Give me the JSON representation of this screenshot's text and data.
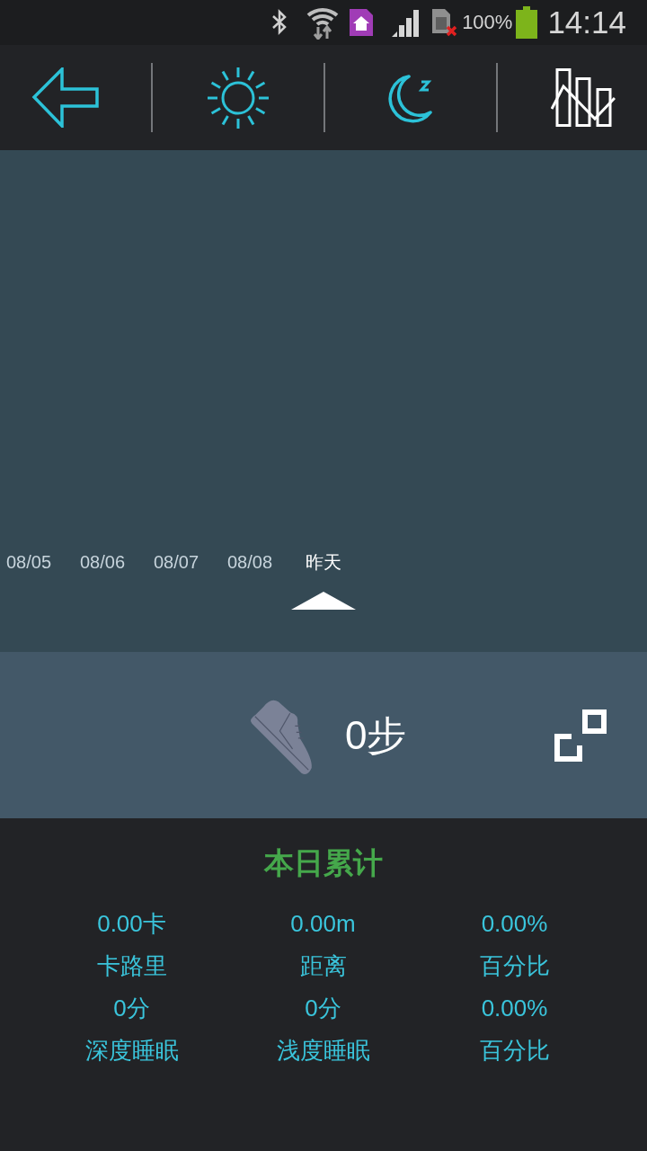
{
  "status_bar": {
    "battery_text": "100%",
    "time": "14:14"
  },
  "timeline": {
    "dates": [
      {
        "label": "08/05",
        "selected": false
      },
      {
        "label": "08/06",
        "selected": false
      },
      {
        "label": "08/07",
        "selected": false
      },
      {
        "label": "08/08",
        "selected": false
      },
      {
        "label": "昨天",
        "selected": true
      }
    ]
  },
  "steps": {
    "text": "0步"
  },
  "summary": {
    "title": "本日累计",
    "stats": [
      {
        "value": "0.00卡",
        "label": "卡路里"
      },
      {
        "value": "0.00m",
        "label": "距离"
      },
      {
        "value": "0.00%",
        "label": "百分比"
      },
      {
        "value": "0分",
        "label": "深度睡眠"
      },
      {
        "value": "0分",
        "label": "浅度睡眠"
      },
      {
        "value": "0.00%",
        "label": "百分比"
      }
    ]
  }
}
